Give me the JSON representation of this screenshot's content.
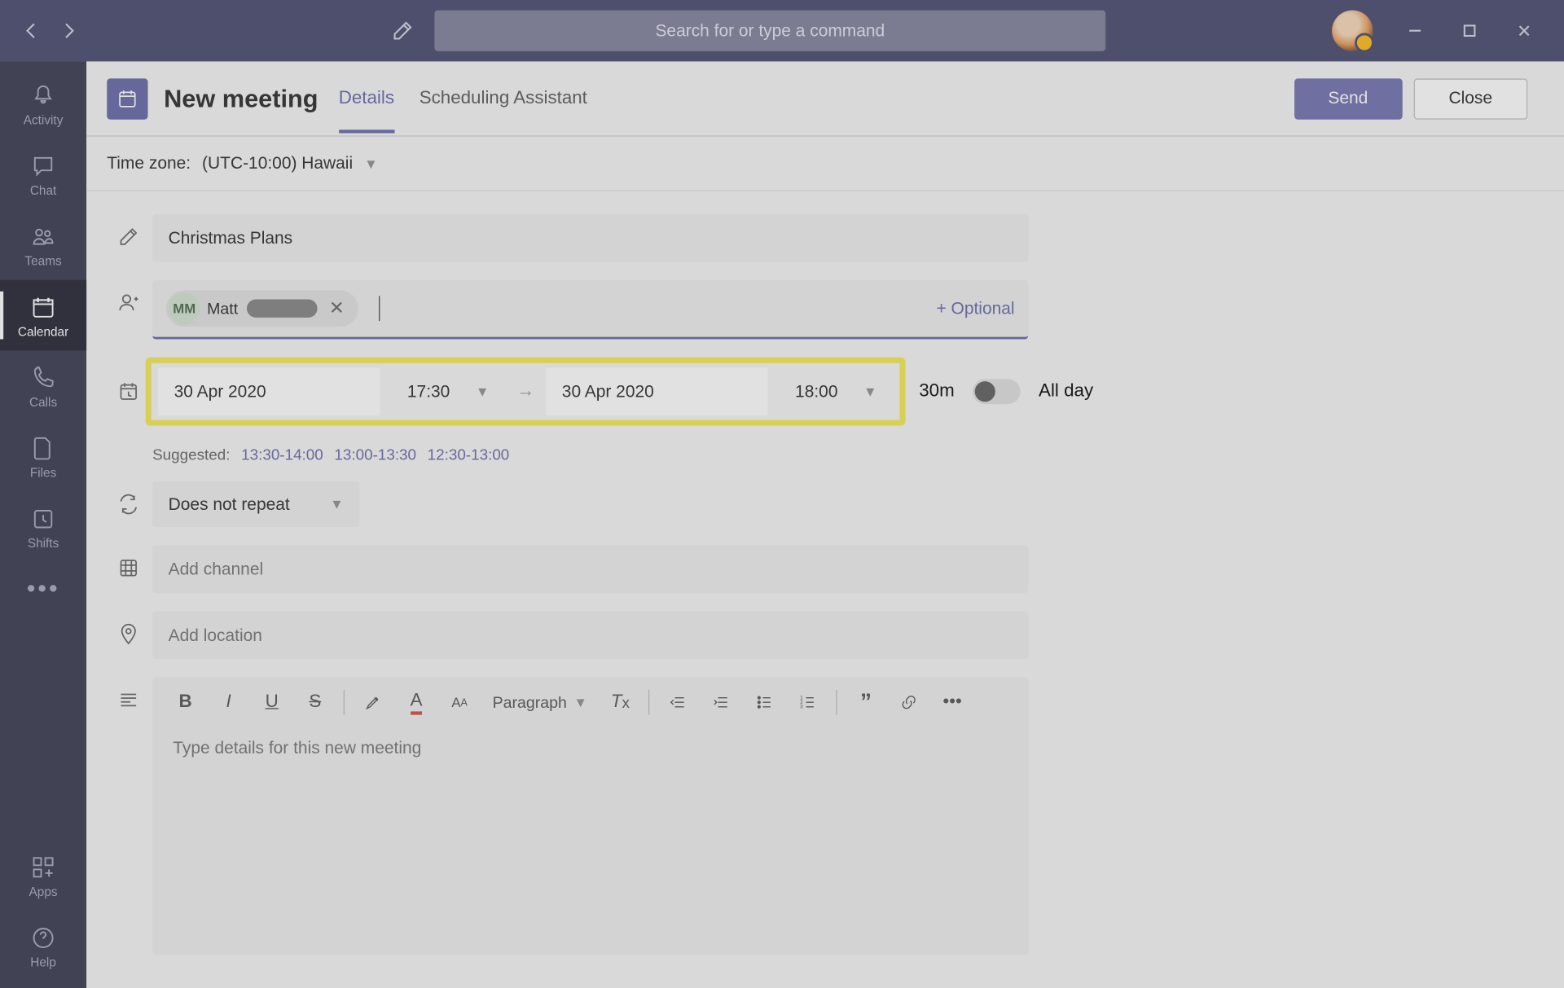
{
  "search": {
    "placeholder": "Search for or type a command"
  },
  "sidebar": {
    "items": [
      {
        "label": "Activity"
      },
      {
        "label": "Chat"
      },
      {
        "label": "Teams"
      },
      {
        "label": "Calendar"
      },
      {
        "label": "Calls"
      },
      {
        "label": "Files"
      },
      {
        "label": "Shifts"
      }
    ],
    "apps": "Apps",
    "help": "Help"
  },
  "header": {
    "title": "New meeting",
    "tabs": {
      "details": "Details",
      "scheduling": "Scheduling Assistant"
    },
    "send": "Send",
    "close": "Close"
  },
  "timezone": {
    "label": "Time zone:",
    "value": "(UTC-10:00) Hawaii"
  },
  "form": {
    "subject": "Christmas Plans",
    "attendee": {
      "initials": "MM",
      "name": "Matt"
    },
    "optional": "+ Optional",
    "start_date": "30 Apr 2020",
    "start_time": "17:30",
    "end_date": "30 Apr 2020",
    "end_time": "18:00",
    "duration": "30m",
    "allday": "All day",
    "suggested_label": "Suggested:",
    "suggested": [
      "13:30-14:00",
      "13:00-13:30",
      "12:30-13:00"
    ],
    "repeat": "Does not repeat",
    "channel_placeholder": "Add channel",
    "location_placeholder": "Add location",
    "paragraph": "Paragraph",
    "details_placeholder": "Type details for this new meeting"
  }
}
